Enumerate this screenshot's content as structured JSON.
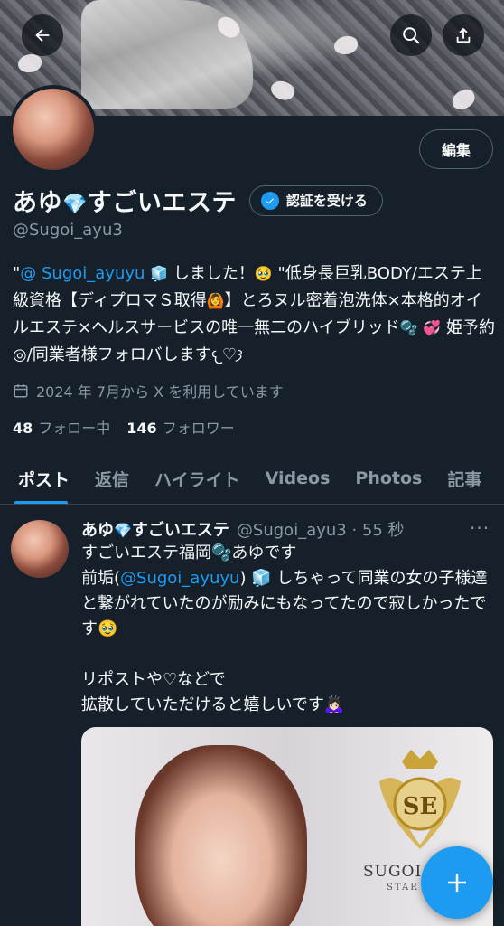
{
  "header": {
    "back_icon": "arrow-left-icon",
    "search_icon": "search-icon",
    "share_icon": "share-icon"
  },
  "profile": {
    "display_name_a": "あゆ",
    "display_name_emoji": "💎",
    "display_name_b": "すごいエステ",
    "handle": "@Sugoi_ayu3",
    "edit_label": "編集",
    "verify_label": "認証を受ける",
    "bio_prefix": "\"",
    "bio_mention": "@ Sugoi_ayuyu",
    "bio_emoji1": "🧊",
    "bio_part1": "しました！",
    "bio_emoji2": "🥹",
    "bio_part2": "\"低身長巨乳BODY/エステ上級資格【ディプロマＳ取得",
    "bio_emoji3": "🙆",
    "bio_part3": "】とろヌル密着泡洗体×本格的オイルエステ×ヘルスサービスの唯一無二のハイブリッド",
    "bio_emoji4": "🫧",
    "bio_emoji5": "💞",
    "bio_part4": "姫予約◎/同業者様フォロバします𐔌♡𐦯",
    "joined": "2024 年 7月から X を利用しています",
    "following_count": "48",
    "following_label": "フォロー中",
    "followers_count": "146",
    "followers_label": "フォロワー"
  },
  "tabs": [
    {
      "label": "ポスト"
    },
    {
      "label": "返信"
    },
    {
      "label": "ハイライト"
    },
    {
      "label": "Videos"
    },
    {
      "label": "Photos"
    },
    {
      "label": "記事"
    }
  ],
  "post": {
    "name_a": "あゆ",
    "name_emoji": "💎",
    "name_b": "すごいエステ",
    "meta": "@Sugoi_ayu3 · 55 秒",
    "line1": "すごいエステ福岡🫧あゆです",
    "line2_a": "前垢(",
    "line2_mention": "@Sugoi_ayuyu",
    "line2_b": ") 🧊 しちゃって同業の女の子様達と繋がれていたのが励みにもなってたので寂しかったです🥹",
    "line3": "リポストや♡などで",
    "line4": "拡散していただけると嬉しいです🙇🏻‍♀️",
    "media_logo_text": "SUGOI E",
    "media_logo_sub": "STAR C"
  },
  "fab": {
    "icon": "plus-icon"
  },
  "colors": {
    "background": "#15202b",
    "accent": "#1d9bf0",
    "muted": "#8b98a5",
    "border": "#536471"
  }
}
